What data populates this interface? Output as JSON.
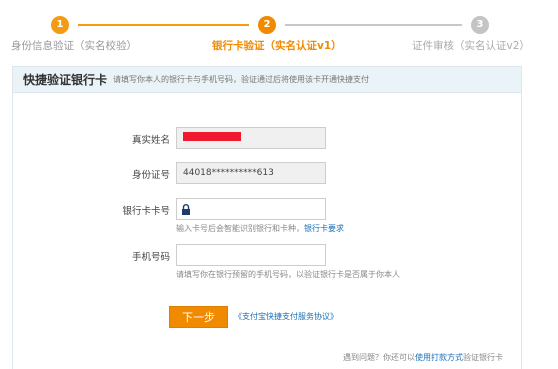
{
  "steps": [
    {
      "number": "1",
      "label": "身份信息验证（实名校验）",
      "state": "done"
    },
    {
      "number": "2",
      "label": "银行卡验证（实名认证v1）",
      "state": "active"
    },
    {
      "number": "3",
      "label": "证件审核（实名认证v2）",
      "state": "todo"
    }
  ],
  "card": {
    "title": "快捷验证银行卡",
    "subtitle": "请填写你本人的银行卡与手机号码，验证通过后将使用该卡开通快捷支付"
  },
  "form": {
    "name_label": "真实姓名",
    "id_label": "身份证号",
    "id_value": "44018**********613",
    "card_label": "银行卡卡号",
    "card_hint": "输入卡号后会智能识别银行和卡种，",
    "card_hint_link": "银行卡要求",
    "phone_label": "手机号码",
    "phone_hint": "请填写你在银行预留的手机号码，以验证银行卡是否属于你本人"
  },
  "actions": {
    "next_label": "下一步",
    "agreement_link": "《支付宝快捷支付服务协议》"
  },
  "footer": {
    "prefix": "遇到问题？你还可以",
    "link": "使用打款方式",
    "suffix": "验证银行卡"
  },
  "colors": {
    "accent": "#f08a00",
    "link": "#1a6fb8",
    "redacted": "#f0192e",
    "header_bg": "#eaf3f8"
  }
}
